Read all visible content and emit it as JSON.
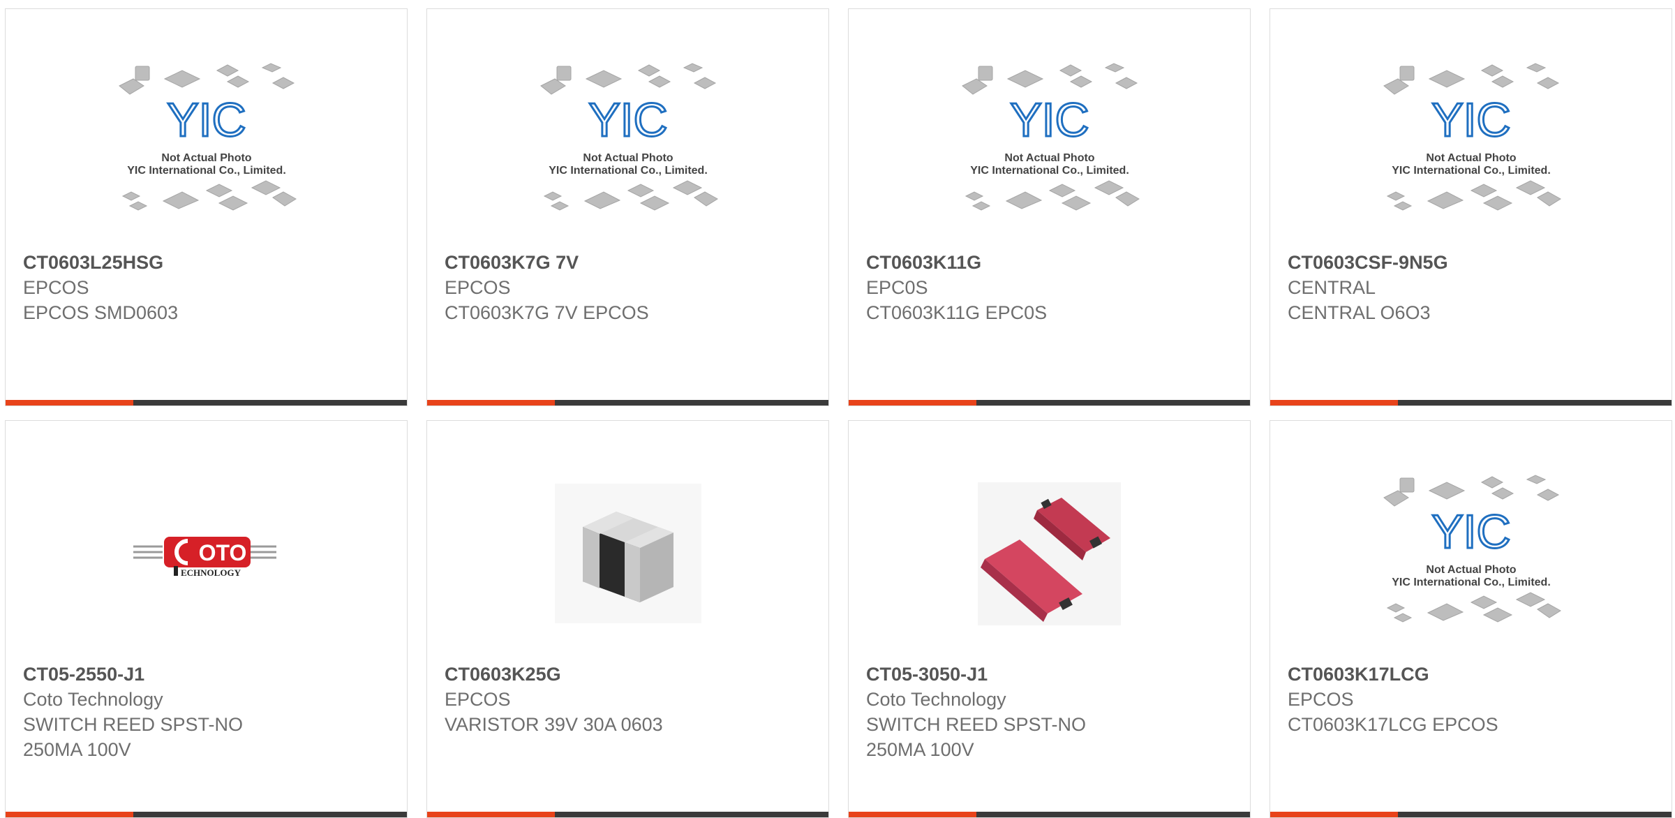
{
  "colors": {
    "accent": "#e8431a",
    "bar": "#3a3a3a",
    "yic_blue": "#1f6fc0",
    "coto_red": "#d62027"
  },
  "placeholder": {
    "logo": "YIC",
    "line1": "Not Actual Photo",
    "line2": "YIC International Co., Limited."
  },
  "coto_logo": {
    "word": "OTO",
    "sub": "ECHNOLOGY"
  },
  "products": [
    {
      "part": "CT0603L25HSG",
      "manufacturer": "EPCOS",
      "description": "EPCOS SMD0603",
      "image": "placeholder-photo"
    },
    {
      "part": "CT0603K7G 7V",
      "manufacturer": "EPCOS",
      "description": "CT0603K7G 7V EPCOS",
      "image": "placeholder-photo"
    },
    {
      "part": "CT0603K11G",
      "manufacturer": "EPC0S",
      "description": "CT0603K11G EPC0S",
      "image": "placeholder-photo"
    },
    {
      "part": "CT0603CSF-9N5G",
      "manufacturer": "CENTRAL",
      "description": "CENTRAL O6O3",
      "image": "placeholder-photo"
    },
    {
      "part": "CT05-2550-J1",
      "manufacturer": "Coto Technology",
      "description": "SWITCH REED SPST-NO\n250MA 100V",
      "image": "coto-logo"
    },
    {
      "part": "CT0603K25G",
      "manufacturer": "EPCOS",
      "description": "VARISTOR 39V 30A 0603",
      "image": "smd-chip-photo"
    },
    {
      "part": "CT05-3050-J1",
      "manufacturer": "Coto Technology",
      "description": "SWITCH REED SPST-NO\n250MA 100V",
      "image": "reed-switch-photo"
    },
    {
      "part": "CT0603K17LCG",
      "manufacturer": "EPCOS",
      "description": "CT0603K17LCG EPCOS",
      "image": "placeholder-photo"
    }
  ]
}
